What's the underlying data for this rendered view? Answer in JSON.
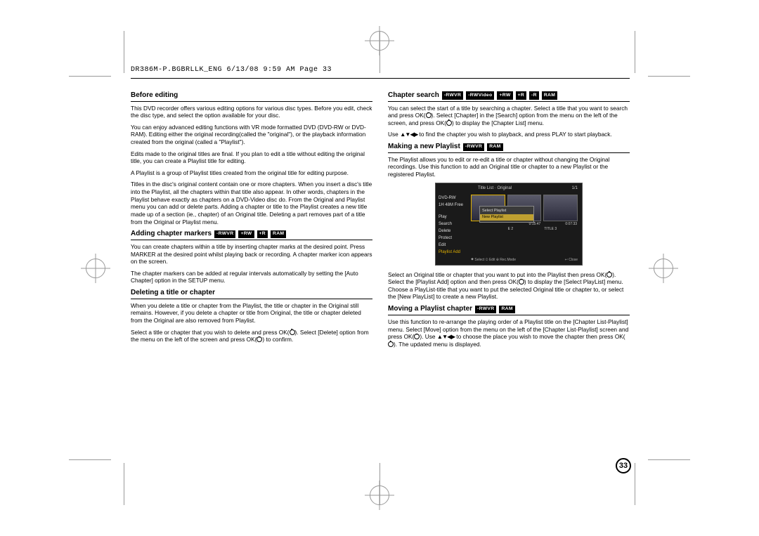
{
  "header": "DR386M-P.BGBRLLK_ENG  6/13/08  9:59 AM  Page 33",
  "page_number": "33",
  "left": {
    "s1": {
      "title": "Before editing",
      "p1": "This DVD recorder offers various editing options for various disc types. Before you edit, check the disc type, and select the option available for your disc.",
      "p2": "You can enjoy advanced editing functions with VR mode formatted DVD (DVD-RW or DVD-RAM). Editing either the original recording(called the \"original\"), or the playback information created from the original (called a \"Playlist\").",
      "p3": "Edits made to the original titles are final. If you plan to edit a title without editing the original title, you can create a Playlist title for editing.",
      "p4": "A Playlist is a group of Playlist titles created from the original title for editing purpose.",
      "p5": "Titles in the disc's original content contain one or more chapters. When you insert a disc's title into the Playlist, all the chapters within that title also appear. In other words, chapters in the Playlist behave exactly as chapters on a DVD-Video disc do. From the Original and Playlist menu you can add or delete parts. Adding a chapter or title to the Playlist creates a new title made up of a section (ie., chapter) of an Original title. Deleting a part removes part of a title from the Original or Playlist menu."
    },
    "s2": {
      "title": "Adding chapter markers",
      "badges": [
        "-RWVR",
        "+RW",
        "+R",
        "RAM"
      ],
      "p1": "You can create chapters within a title by inserting chapter marks at the desired point. Press MARKER at the desired point whilst playing back or recording. A chapter marker icon appears on the screen.",
      "p2": "The chapter markers can be added at regular intervals automatically by setting the [Auto Chapter] option in the SETUP menu."
    },
    "s3": {
      "title": "Deleting a title or chapter",
      "p1": "When you delete a title or chapter from the Playlist, the title or chapter in the Original still remains. However, if you delete a chapter or title from Original, the title or chapter deleted from the Original are also removed from Playlist.",
      "p2a": "Select a title or chapter that you wish to delete and press OK(",
      "p2b": "). Select [Delete] option from the menu on the left of the screen and press OK(",
      "p2c": ") to confirm."
    }
  },
  "right": {
    "s1": {
      "title": "Chapter search",
      "badges": [
        "-RWVR",
        "-RWVideo",
        "+RW",
        "+R",
        "-R",
        "RAM"
      ],
      "p1a": "You can select the start of a title by searching a chapter. Select a title that you want to search and press OK(",
      "p1b": "). Select [Chapter] in the [Search] option from the menu on the left of the screen, and press OK(",
      "p1c": ") to display the [Chapter List] menu.",
      "p2a": "Use ",
      "p2nav": "▲▼◀▶",
      "p2b": " to find the chapter you wish to playback, and press PLAY to start playback."
    },
    "s2": {
      "title": "Making a new Playlist",
      "badges": [
        "-RWVR",
        "RAM"
      ],
      "p1": "The Playlist allows you to edit or re-edit a title or chapter without changing the Original recordings. Use this function to add an Original title or chapter to a new Playlist or the registered Playlist.",
      "p2a": "Select an Original title or chapter that you want to put into the Playlist then press OK(",
      "p2b": "). Select the [Playlist Add] option and then press OK(",
      "p2c": ") to display the [Select PlayList] menu. Choose a PlayList-title that you want to put the selected Original title or chapter to, or select the [New PlayList] to create a new Playlist."
    },
    "s3": {
      "title": "Moving a Playlist chapter",
      "badges": [
        "-RWVR",
        "RAM"
      ],
      "p1a": "Use this function to re-arrange the playing order of a Playlist title on the [Chapter List-Playlist] menu. Select [Move] option from the menu on the left of the [Chapter List-Playlist] screen and press OK(",
      "p1b": "). Use ",
      "p1nav": "▲▼◀▶",
      "p1c": " to choose the place you wish to move the chapter then press OK(",
      "p1d": "). The updated menu is displayed."
    }
  },
  "figure": {
    "header": "Title List · Original",
    "page": "1/1",
    "disc": "DVD-RW",
    "time": "1H 48M Free",
    "menu": [
      "Play",
      "Search",
      "Delete",
      "Protect",
      "Edit",
      "Playlist Add"
    ],
    "popup_title": "Select Playlist",
    "popup_item": "New Playlist",
    "t2_name": "E 2",
    "t2_time": "0:15:47",
    "t3_name": "TITLE 3",
    "t3_time": "0:07:33",
    "foot_left": "⯁ Select   ⊙ Edit   ⊕ Rec.Mode",
    "foot_right": "↩ Close"
  }
}
